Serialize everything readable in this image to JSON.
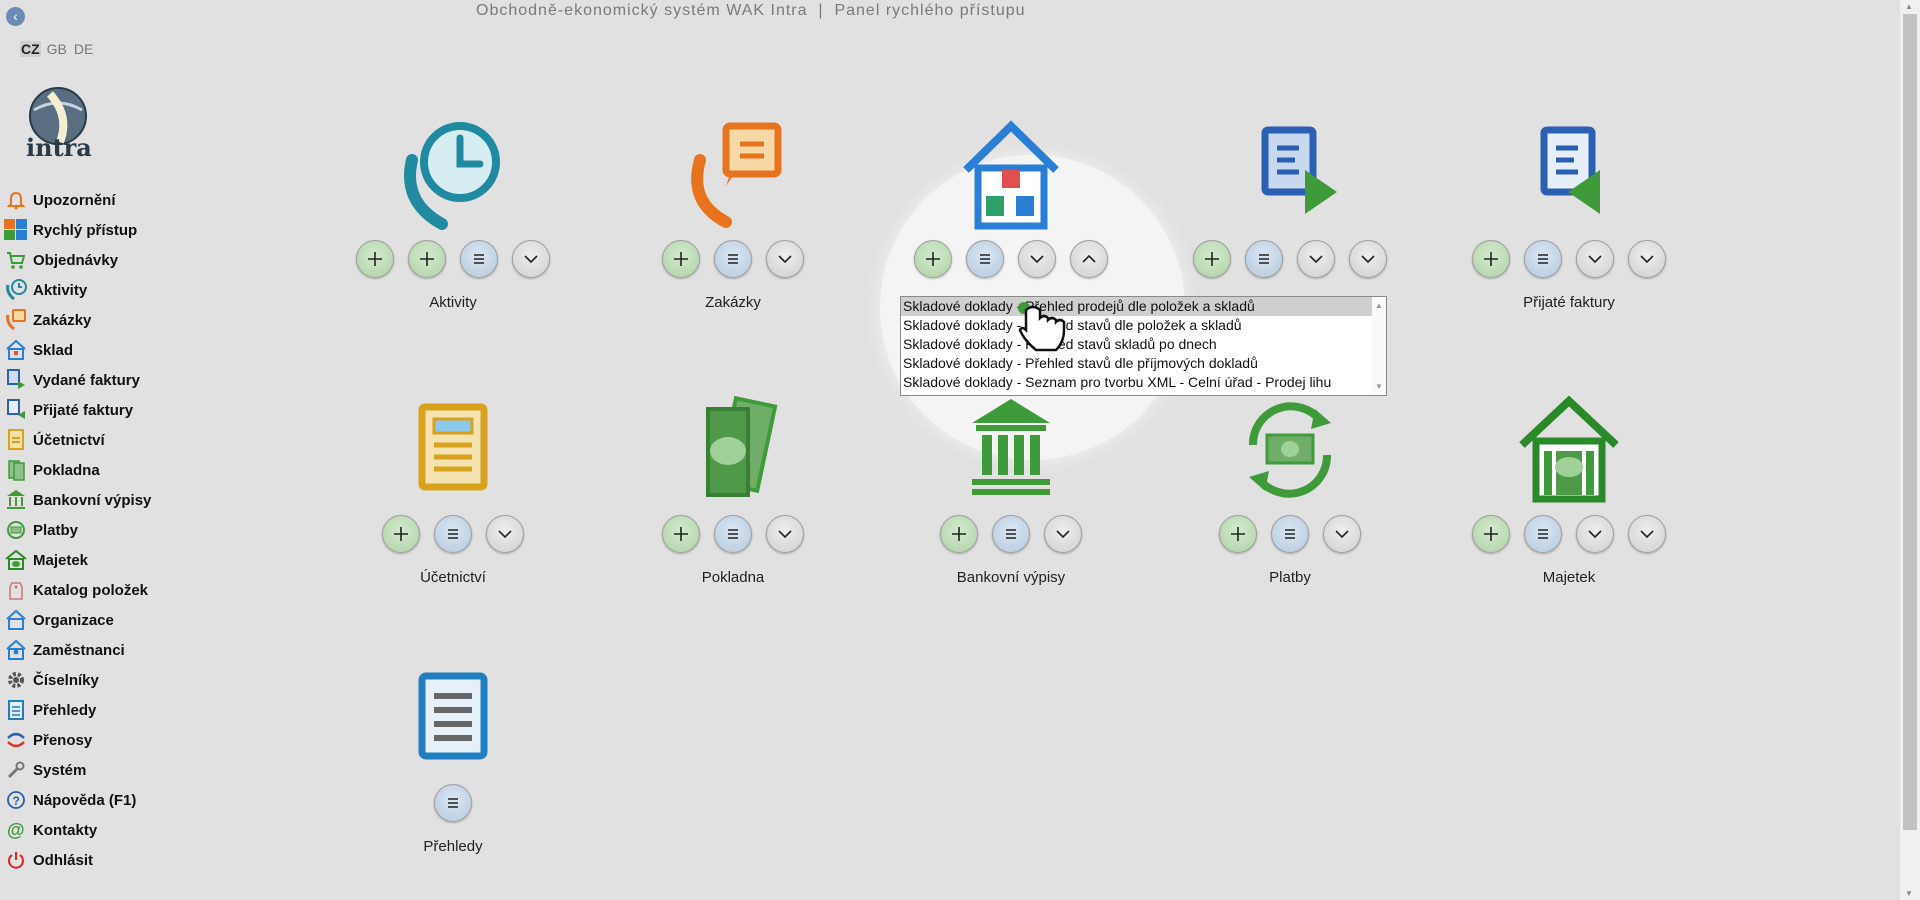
{
  "header": {
    "title": "Obchodně-ekonomický systém WAK Intra  |  Panel rychlého přístupu"
  },
  "languages": [
    "CZ",
    "GB",
    "DE"
  ],
  "logo": {
    "text": "intra"
  },
  "sidebar": {
    "items": [
      {
        "label": "Upozornění",
        "icon": "bell-icon"
      },
      {
        "label": "Rychlý přístup",
        "icon": "quick-access-icon"
      },
      {
        "label": "Objednávky",
        "icon": "cart-icon"
      },
      {
        "label": "Aktivity",
        "icon": "phone-clock-icon"
      },
      {
        "label": "Zakázky",
        "icon": "phone-order-icon"
      },
      {
        "label": "Sklad",
        "icon": "warehouse-icon"
      },
      {
        "label": "Vydané faktury",
        "icon": "issued-invoice-icon"
      },
      {
        "label": "Přijaté faktury",
        "icon": "received-invoice-icon"
      },
      {
        "label": "Účetnictví",
        "icon": "accounting-icon"
      },
      {
        "label": "Pokladna",
        "icon": "cash-icon"
      },
      {
        "label": "Bankovní výpisy",
        "icon": "bank-icon"
      },
      {
        "label": "Platby",
        "icon": "payments-icon"
      },
      {
        "label": "Majetek",
        "icon": "property-icon"
      },
      {
        "label": "Katalog položek",
        "icon": "tag-icon"
      },
      {
        "label": "Organizace",
        "icon": "organization-icon"
      },
      {
        "label": "Zaměstnanci",
        "icon": "employees-icon"
      },
      {
        "label": "Číselníky",
        "icon": "gear-icon"
      },
      {
        "label": "Přehledy",
        "icon": "overview-icon"
      },
      {
        "label": "Přenosy",
        "icon": "transfer-icon"
      },
      {
        "label": "Systém",
        "icon": "wrench-icon"
      },
      {
        "label": "Nápověda (F1)",
        "icon": "help-icon"
      },
      {
        "label": "Kontakty",
        "icon": "at-icon"
      },
      {
        "label": "Odhlásit",
        "icon": "power-icon"
      }
    ]
  },
  "tiles": [
    {
      "label": "Aktivity",
      "icon": "phone-clock-icon"
    },
    {
      "label": "Zakázky",
      "icon": "phone-order-icon"
    },
    {
      "label": "",
      "icon": "warehouse-icon"
    },
    {
      "label": "",
      "icon": "issued-invoice-icon"
    },
    {
      "label": "Přijaté faktury",
      "icon": "received-invoice-icon"
    },
    {
      "label": "Účetnictví",
      "icon": "accounting-icon"
    },
    {
      "label": "Pokladna",
      "icon": "cash-icon"
    },
    {
      "label": "Bankovní výpisy",
      "icon": "bank-icon"
    },
    {
      "label": "Platby",
      "icon": "payments-icon"
    },
    {
      "label": "Majetek",
      "icon": "property-icon"
    },
    {
      "label": "Přehledy",
      "icon": "overview-icon"
    }
  ],
  "dropdown": {
    "items": [
      "Skladové doklady - Přehled prodejů dle položek a skladů",
      "Skladové doklady - Přehled stavů dle položek a skladů",
      "Skladové doklady - Přehled stavů skladů po dnech",
      "Skladové doklady - Přehled stavů dle příjmových dokladů",
      "Skladové doklady - Seznam pro tvorbu XML - Celní úřad - Prodej lihu"
    ],
    "selected_index": 0
  },
  "colors": {
    "background": "#e1e1e1",
    "add_button": "#c4e2bc",
    "list_button": "#c9d8ea",
    "teal": "#1f8aa0",
    "orange": "#e8731f",
    "blue": "#2a7fd4",
    "gold": "#d8a21d",
    "green": "#3f9a3a"
  }
}
